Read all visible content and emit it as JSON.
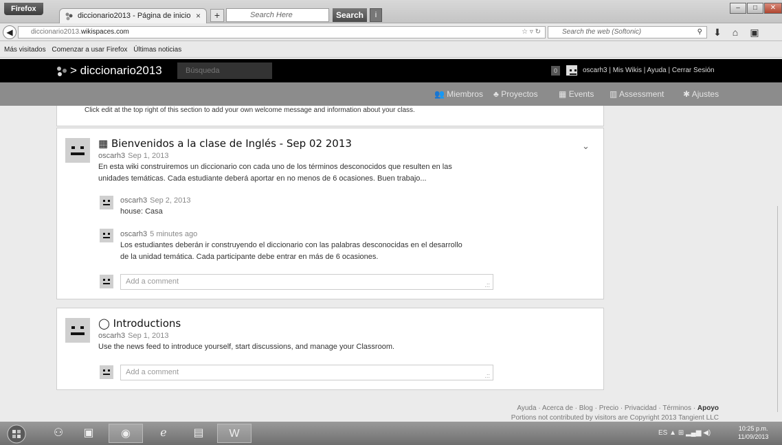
{
  "browser": {
    "menu_button": "Firefox",
    "tab_title": "diccionario2013 - Página de inicio",
    "tab_close": "×",
    "new_tab": "+",
    "toolbar_search_placeholder": "Search Here",
    "toolbar_search_button": "Search",
    "url_host_prefix": "diccionario2013.",
    "url_host": "wikispaces.com",
    "web_search_placeholder": "Search the web (Softonic)",
    "bookmarks": [
      "Más visitados",
      "Comenzar a usar Firefox",
      "Últimas noticias"
    ]
  },
  "wiki": {
    "breadcrumb_sep": ">",
    "name": "diccionario2013",
    "search_placeholder": "Búsqueda",
    "notification_count": "0",
    "user_links": "oscarh3 | Mis Wikis | Ayuda | Cerrar Sesión",
    "nav": [
      {
        "icon": "members-icon",
        "label": "Miembros"
      },
      {
        "icon": "projects-icon",
        "label": "Proyectos"
      },
      {
        "icon": "events-icon",
        "label": "Events"
      },
      {
        "icon": "assessment-icon",
        "label": "Assessment"
      },
      {
        "icon": "settings-icon",
        "label": "Ajustes"
      }
    ]
  },
  "feed": {
    "welcome_text": "Click edit at the top right of this section to add your own welcome message and information about your class.",
    "posts": [
      {
        "title": "Bienvenidos a la clase de Inglés - Sep 02 2013",
        "author": "oscarh3",
        "date": "Sep 1, 2013",
        "body_line1": "En esta wiki construiremos un diccionario con cada uno de los términos desconocidos que resulten en las",
        "body_line2": "unidades temáticas. Cada estudiante deberá aportar en no menos de 6 ocasiones. Buen trabajo...",
        "replies": [
          {
            "author": "oscarh3",
            "date": "Sep 2, 2013",
            "line1": "house: Casa",
            "line2": ""
          },
          {
            "author": "oscarh3",
            "date": "5 minutes ago",
            "line1": "Los estudiantes deberán ir construyendo el diccionario con las palabras desconocidas en el desarrollo",
            "line2": "de la unidad temática. Cada participante debe entrar en más de 6 ocasiones."
          }
        ],
        "comment_placeholder": "Add a comment"
      },
      {
        "title": "Introductions",
        "author": "oscarh3",
        "date": "Sep 1, 2013",
        "body_line1": "Use the news feed to introduce yourself, start discussions, and manage your Classroom.",
        "comment_placeholder": "Add a comment"
      }
    ]
  },
  "footer": {
    "links": "Ayuda · Acerca de · Blog · Precio · Privacidad · Términos · ",
    "links_bold": "Apoyo",
    "copyright": "Portions not contributed by visitors are Copyright 2013 Tangient LLC"
  },
  "taskbar": {
    "language": "ES",
    "time": "10:25 p.m.",
    "date": "11/09/2013"
  }
}
